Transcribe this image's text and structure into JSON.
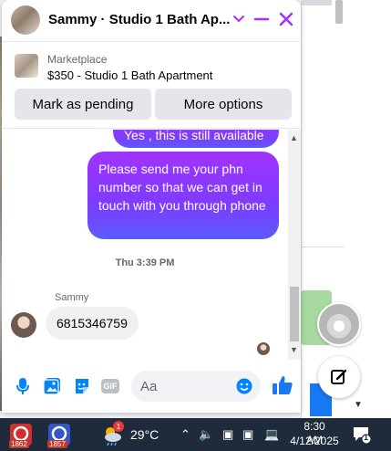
{
  "chat": {
    "title": "Sammy · Studio 1 Bath Ap...",
    "listing": {
      "source": "Marketplace",
      "title": "$350 - Studio 1 Bath Apartment",
      "buttons": [
        "Mark as pending",
        "More options"
      ]
    },
    "messages": {
      "outgoing_1": "Yes , this is still available",
      "outgoing_2": "Please send me your phn number so that we can get in touch with you through phone",
      "timestamp": "Thu 3:39 PM",
      "sender_name": "Sammy",
      "incoming_1": "6815346759"
    },
    "composer": {
      "placeholder": "Aa",
      "gif_label": "GIF"
    },
    "colors": {
      "accent": "#a033ff",
      "accent_end": "#5b5bff",
      "like": "#1877f2"
    }
  },
  "taskbar": {
    "apps": [
      {
        "badge": "1862",
        "icon": "app-icon"
      },
      {
        "badge": "1857",
        "icon": "app-icon"
      }
    ],
    "weather_badge": "1",
    "temperature": "29°C",
    "time": "8:30 AM",
    "date": "4/12/2025",
    "notification_count": "1"
  }
}
